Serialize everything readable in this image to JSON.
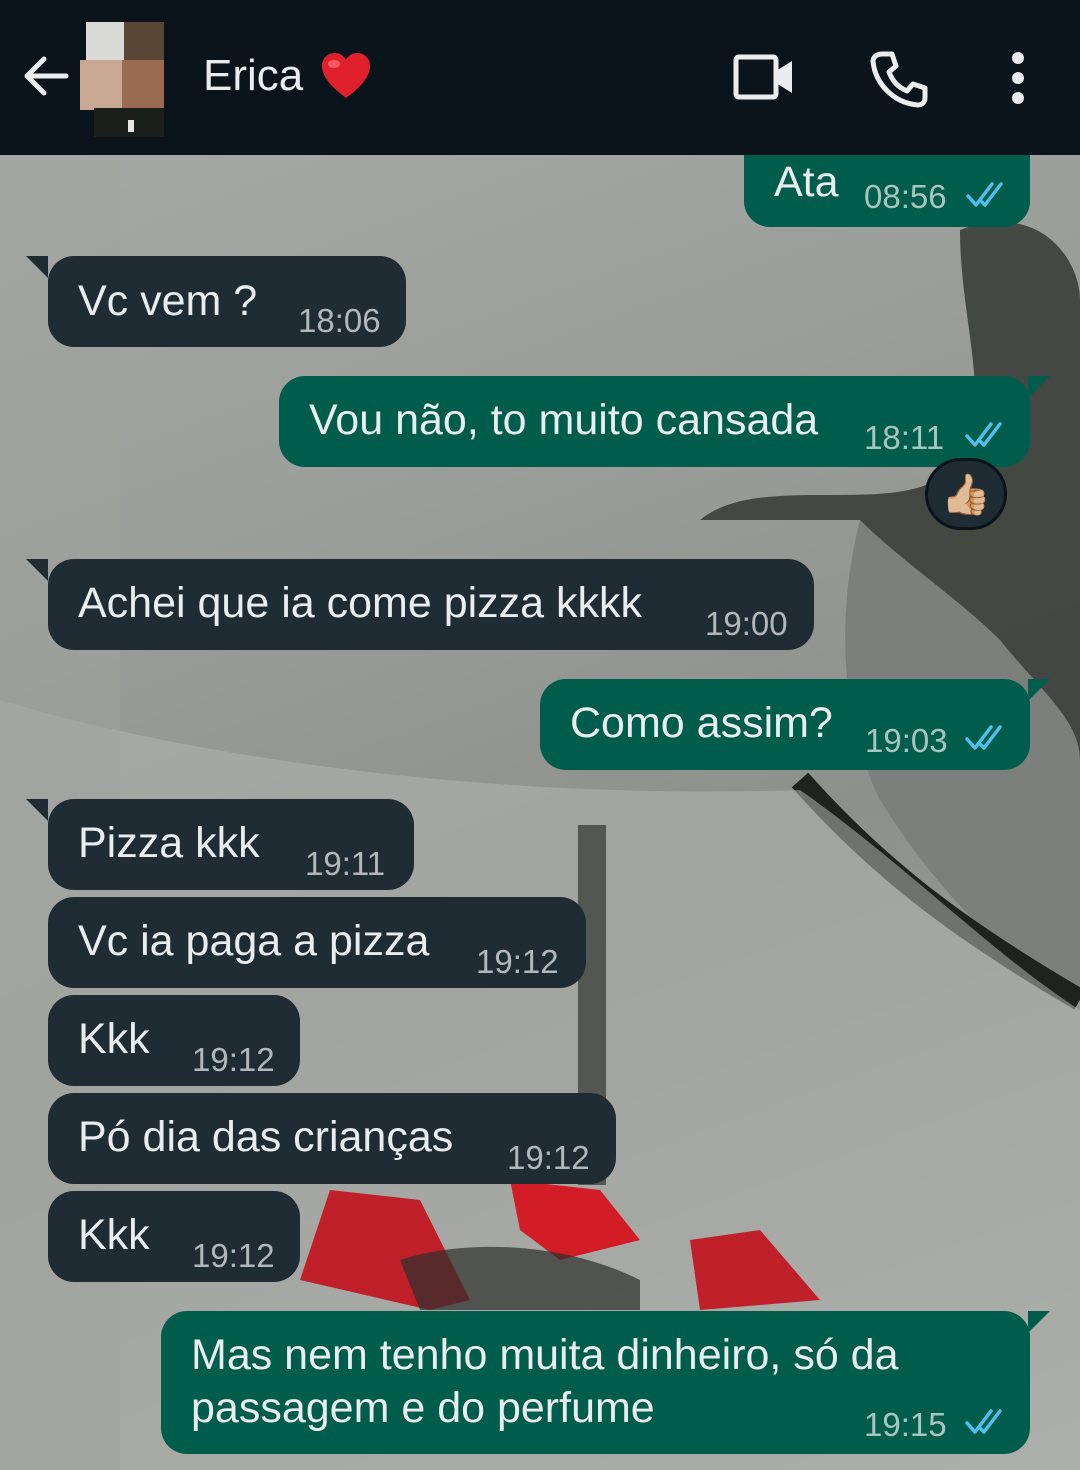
{
  "header": {
    "contact_name": "Erica",
    "heart_icon": "red-heart-emoji",
    "icons": [
      "back-arrow-icon",
      "video-call-icon",
      "voice-call-icon",
      "more-options-icon"
    ]
  },
  "colors": {
    "header_bg": "#0b141a",
    "incoming_bubble": "#202c33",
    "outgoing_bubble": "#005c4b",
    "read_ticks": "#53bdeb"
  },
  "messages": [
    {
      "dir": "out",
      "text": "Ata",
      "time": "08:56",
      "read": true
    },
    {
      "dir": "in",
      "text": "Vc vem ?",
      "time": "18:06"
    },
    {
      "dir": "out",
      "text": "Vou não, to muito cansada",
      "time": "18:11",
      "read": true,
      "reaction": "👍🏼"
    },
    {
      "dir": "in",
      "text": "Achei que ia come pizza kkkk",
      "time": "19:00"
    },
    {
      "dir": "out",
      "text": "Como assim?",
      "time": "19:03",
      "read": true
    },
    {
      "dir": "in",
      "text": "Pizza kkk",
      "time": "19:11"
    },
    {
      "dir": "in",
      "text": "Vc ia paga a pizza",
      "time": "19:12"
    },
    {
      "dir": "in",
      "text": "Kkk",
      "time": "19:12"
    },
    {
      "dir": "in",
      "text": "Pó dia das crianças",
      "time": "19:12"
    },
    {
      "dir": "in",
      "text": "Kkk",
      "time": "19:12"
    },
    {
      "dir": "out",
      "text_line1": "Mas nem tenho muita dinheiro, só da",
      "text_line2": "passagem e do perfume",
      "time": "19:15",
      "read": true
    }
  ]
}
